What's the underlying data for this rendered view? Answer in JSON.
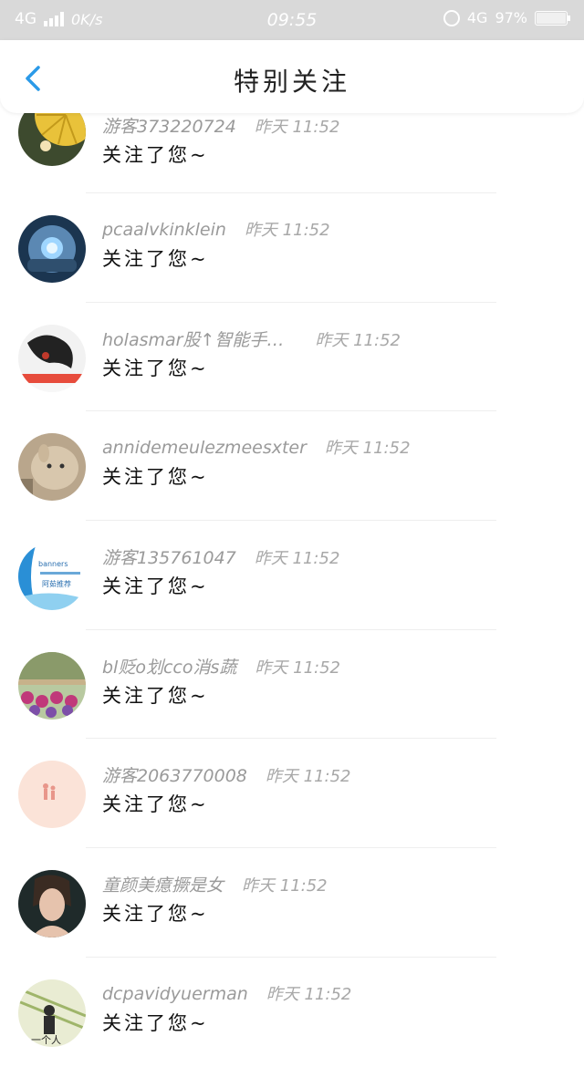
{
  "status_bar": {
    "network": "4G",
    "speed": "0K/s",
    "time": "09:55",
    "right_network": "4G",
    "battery": "97%"
  },
  "header": {
    "back_icon": "chevron-left-icon",
    "title": "特别关注"
  },
  "colors": {
    "accent": "#2b9ae8",
    "status_bar_bg": "#d9d9d9",
    "username": "#9a9a9a",
    "message": "#111111"
  },
  "items": [
    {
      "name": "游客373220724",
      "time": "昨天 11:52",
      "message": "关注了您~",
      "avatar": "avatar-yellow-umbrella"
    },
    {
      "name": "pcaalvkinklein",
      "time": "昨天 11:52",
      "message": "关注了您~",
      "avatar": "avatar-robot"
    },
    {
      "name": "holasmar股↑智能手…",
      "time": "昨天 11:52",
      "message": "关注了您~",
      "avatar": "avatar-sketch-face"
    },
    {
      "name": "annidemeulezmeesxter",
      "time": "昨天 11:52",
      "message": "关注了您~",
      "avatar": "avatar-alpaca"
    },
    {
      "name": "游客135761047",
      "time": "昨天 11:52",
      "message": "关注了您~",
      "avatar": "avatar-blue-banner"
    },
    {
      "name": "bl贬o划cco消s蔬",
      "time": "昨天 11:52",
      "message": "关注了您~",
      "avatar": "avatar-flowers"
    },
    {
      "name": "游客2063770008",
      "time": "昨天 11:52",
      "message": "关注了您~",
      "avatar": "avatar-peach-figure"
    },
    {
      "name": "童颜美癔撅是女",
      "time": "昨天 11:52",
      "message": "关注了您~",
      "avatar": "avatar-woman-portrait"
    },
    {
      "name": "dcpavidyuerman",
      "time": "昨天 11:52",
      "message": "关注了您~",
      "avatar": "avatar-one-person"
    }
  ],
  "avatar_texts": {
    "item4_line1": "banners",
    "item4_line2": "阿茹推荐",
    "item8": "一个人"
  }
}
